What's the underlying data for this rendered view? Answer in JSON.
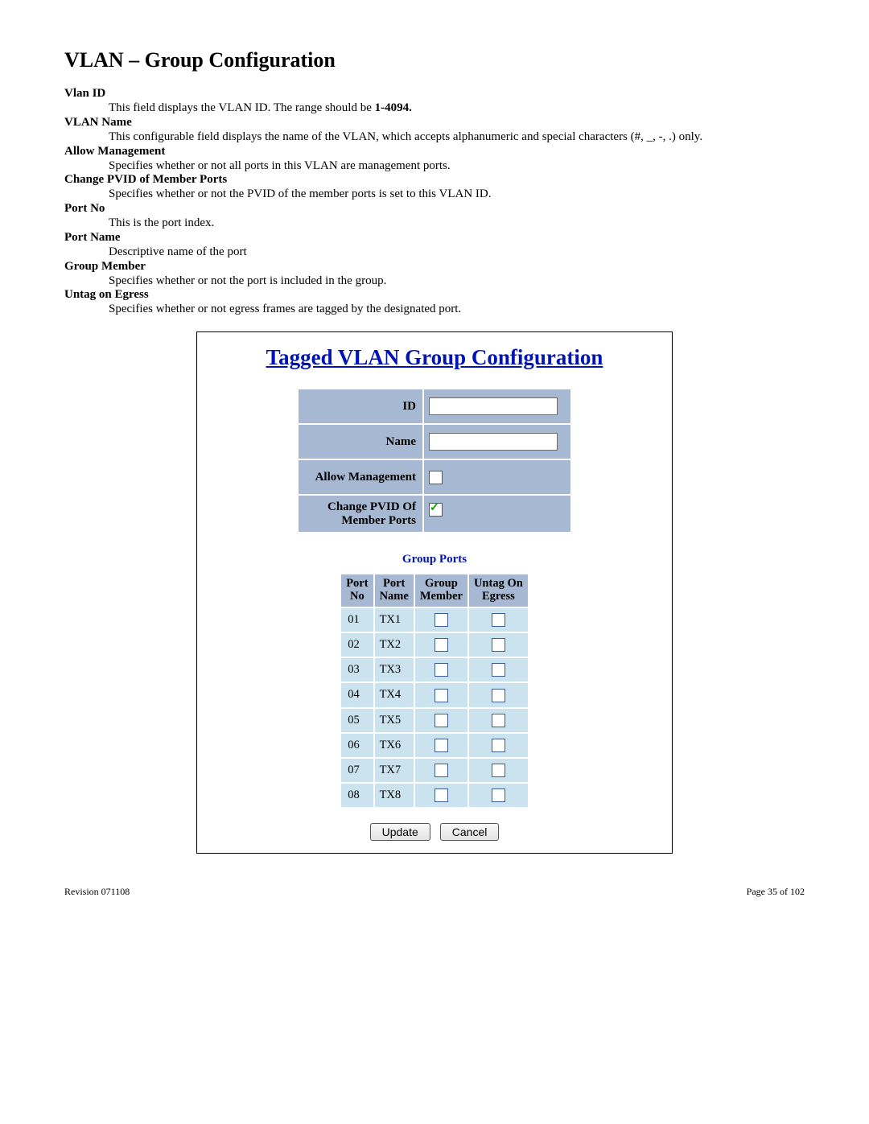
{
  "page_title": "VLAN – Group Configuration",
  "definitions": [
    {
      "term": "Vlan ID",
      "desc_pre": "This field displays the VLAN ID. The range should be ",
      "desc_bold": "1-4094.",
      "desc_post": ""
    },
    {
      "term": "VLAN Name",
      "desc_pre": "This configurable field displays the name of the VLAN, which accepts alphanumeric and special characters (#, _, -, .) only.",
      "desc_bold": "",
      "desc_post": ""
    },
    {
      "term": "Allow Management",
      "desc_pre": "Specifies whether or not all ports in this VLAN are management ports.",
      "desc_bold": "",
      "desc_post": ""
    },
    {
      "term": "Change PVID of Member Ports",
      "desc_pre": "Specifies whether or not the PVID of the member ports is set to this VLAN ID.",
      "desc_bold": "",
      "desc_post": ""
    },
    {
      "term": "Port No",
      "desc_pre": "This is the port index.",
      "desc_bold": "",
      "desc_post": ""
    },
    {
      "term": "Port Name",
      "desc_pre": "Descriptive name of the port",
      "desc_bold": "",
      "desc_post": ""
    },
    {
      "term": "Group Member",
      "desc_pre": "Specifies whether or not the port is included in the group.",
      "desc_bold": "",
      "desc_post": ""
    },
    {
      "term": "Untag on Egress",
      "desc_pre": "Specifies whether or not egress frames are tagged by the designated port.",
      "desc_bold": "",
      "desc_post": ""
    }
  ],
  "config": {
    "title": "Tagged VLAN Group Configuration",
    "id_label": "ID",
    "id_value": "",
    "name_label": "Name",
    "name_value": "",
    "allow_mgmt_label": "Allow Management",
    "allow_mgmt_checked": false,
    "change_pvid_label_line1": "Change PVID Of",
    "change_pvid_label_line2": "Member Ports",
    "change_pvid_checked": true,
    "group_ports_title": "Group Ports",
    "headers": {
      "port_no": "Port No",
      "port_name": "Port Name",
      "group_member": "Group Member",
      "untag_egress": "Untag On Egress"
    },
    "ports": [
      {
        "no": "01",
        "name": "TX1",
        "group_member": false,
        "untag": false
      },
      {
        "no": "02",
        "name": "TX2",
        "group_member": false,
        "untag": false
      },
      {
        "no": "03",
        "name": "TX3",
        "group_member": false,
        "untag": false
      },
      {
        "no": "04",
        "name": "TX4",
        "group_member": false,
        "untag": false
      },
      {
        "no": "05",
        "name": "TX5",
        "group_member": false,
        "untag": false
      },
      {
        "no": "06",
        "name": "TX6",
        "group_member": false,
        "untag": false
      },
      {
        "no": "07",
        "name": "TX7",
        "group_member": false,
        "untag": false
      },
      {
        "no": "08",
        "name": "TX8",
        "group_member": false,
        "untag": false
      }
    ],
    "update_label": "Update",
    "cancel_label": "Cancel"
  },
  "footer": {
    "revision": "Revision 071108",
    "page": "Page 35 of 102"
  }
}
